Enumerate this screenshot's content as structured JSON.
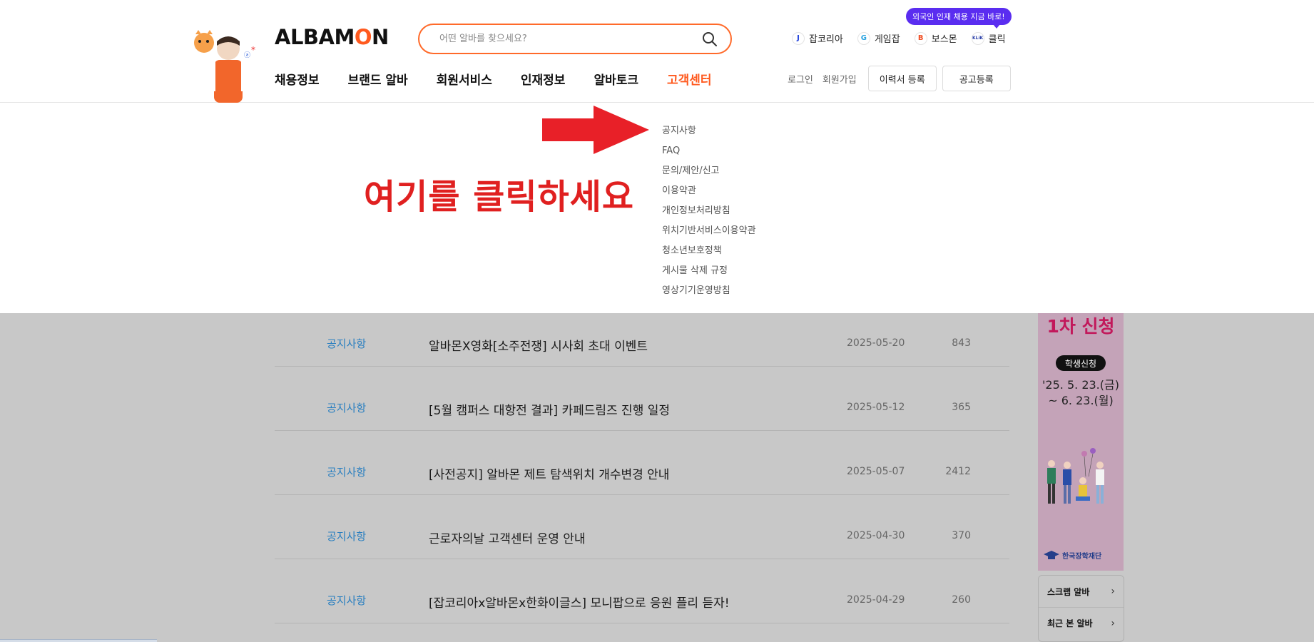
{
  "header": {
    "logo_left": "ALBAM",
    "logo_o": "O",
    "logo_right": "N",
    "search_placeholder": "어떤 알바를 찾으세요?",
    "promo": "외국인 인재 채용 지금 바로!",
    "sites": [
      {
        "label": "잡코리아",
        "badge": "J",
        "color": "#1c3ddb"
      },
      {
        "label": "게임잡",
        "badge": "G",
        "color": "#2aa3e0"
      },
      {
        "label": "보스몬",
        "badge": "B",
        "color": "#f04e23"
      },
      {
        "label": "클릭",
        "badge": "KLiK",
        "color": "#2a3fa8"
      }
    ],
    "nav": [
      "채용정보",
      "브랜드 알바",
      "회원서비스",
      "인재정보",
      "알바토크",
      "고객센터"
    ],
    "util": {
      "login": "로그인",
      "signup": "회원가입",
      "resume": "이력서 등록",
      "post": "공고등록"
    }
  },
  "dropdown": {
    "guide": "여기를 클릭하세요",
    "items": [
      "공지사항",
      "FAQ",
      "문의/제안/신고",
      "이용약관",
      "개인정보처리방침",
      "위치기반서비스이용약관",
      "청소년보호정책",
      "게시물 삭제 규정",
      "영상기기운영방침"
    ]
  },
  "notices": [
    {
      "category": "공지사항",
      "title": "알바몬X영화[소주전쟁] 시사회 초대 이벤트",
      "date": "2025-05-20",
      "views": "843"
    },
    {
      "category": "공지사항",
      "title": "[5월 캠퍼스 대항전 결과] 카페드림즈 진행 일정",
      "date": "2025-05-12",
      "views": "365"
    },
    {
      "category": "공지사항",
      "title": "[사전공지] 알바몬 제트 탐색위치 개수변경 안내",
      "date": "2025-05-07",
      "views": "2412"
    },
    {
      "category": "공지사항",
      "title": "근로자의날 고객센터 운영 안내",
      "date": "2025-04-30",
      "views": "370"
    },
    {
      "category": "공지사항",
      "title": "[잡코리아x알바몬x한화이글스] 모니팝으로 응원 플리 듣자!",
      "date": "2025-04-29",
      "views": "260"
    }
  ],
  "banner": {
    "title": "1차 신청",
    "pill": "학생신청",
    "date1": "'25. 5. 23.(금)",
    "date2": "~ 6. 23.(월)",
    "org": "한국장학재단"
  },
  "quick": {
    "scrap": "스크랩 알바",
    "recent": "최근 본 알바"
  },
  "colors": {
    "accent": "#ff5a1f",
    "link": "#2a7fc0",
    "guide": "#e02020",
    "promo": "#5a2df0"
  }
}
